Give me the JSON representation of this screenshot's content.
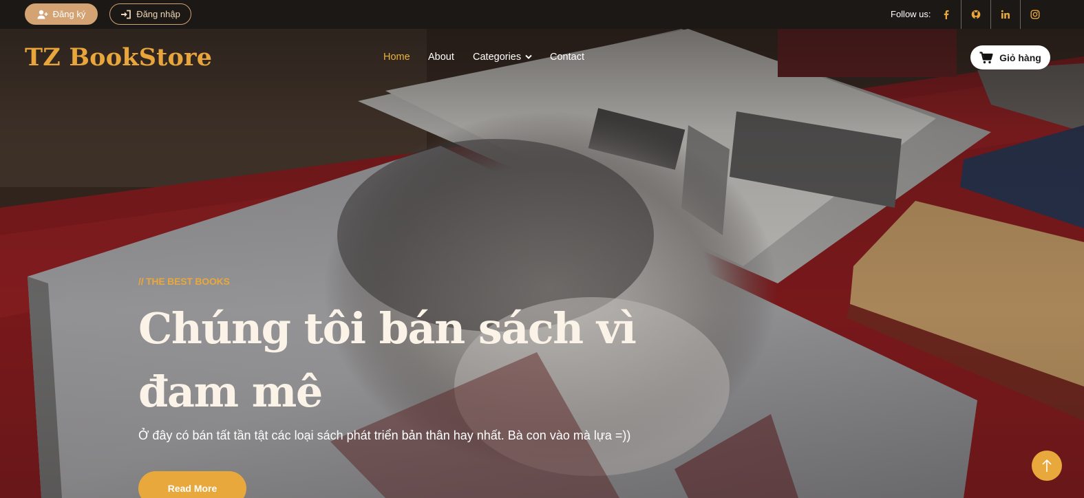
{
  "topbar": {
    "register_label": "Đăng ký",
    "register_icon": "user-plus-icon",
    "login_label": "Đăng nhập",
    "login_icon": "sign-in-icon",
    "follow_label": "Follow us:",
    "socials": [
      "facebook-icon",
      "github-icon",
      "linkedin-icon",
      "instagram-icon"
    ],
    "social_color": "#e8a83c"
  },
  "header": {
    "logo": "TZ BookStore",
    "nav": [
      {
        "label": "Home",
        "active": true
      },
      {
        "label": "About",
        "active": false
      },
      {
        "label": "Categories",
        "active": false,
        "dropdown": true
      },
      {
        "label": "Contact",
        "active": false
      }
    ],
    "cart_label": "Giỏ hàng",
    "cart_icon": "shopping-cart-icon"
  },
  "hero": {
    "eyebrow": "// THE BEST BOOKS",
    "title_line1": "Chúng tôi bán sách vì",
    "title_line2": "đam mê",
    "subtitle": "Ở đây có bán tất tần tật các loại sách phát triển bản thân hay nhất. Bà con vào mà lựa =))",
    "cta_label": "Read More",
    "back_to_top_icon": "arrow-up-icon"
  },
  "colors": {
    "accent": "#e8a83c",
    "register_bg": "#d4a373",
    "topbar_bg": "#1c1815",
    "title_text": "#fbf3e8"
  }
}
